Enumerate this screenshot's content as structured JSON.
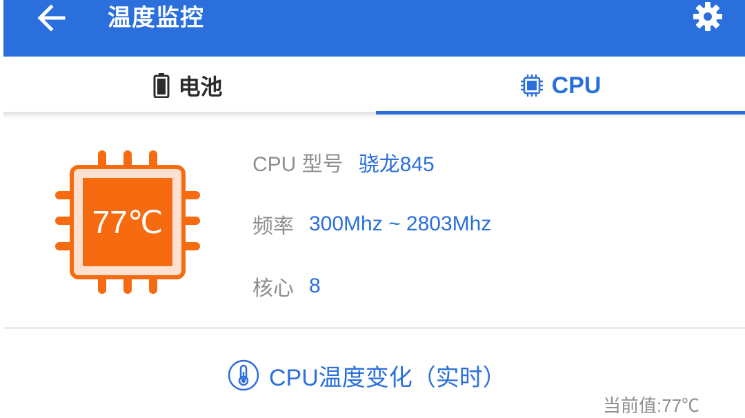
{
  "appbar": {
    "title": "温度监控",
    "back_icon": "arrow-left-icon",
    "settings_icon": "gear-icon"
  },
  "tabs": [
    {
      "label": "电池",
      "icon": "battery-icon",
      "active": false
    },
    {
      "label": "CPU",
      "icon": "cpu-chip-icon",
      "active": true
    }
  ],
  "cpu": {
    "temperature": "77℃",
    "model_label": "CPU 型号",
    "model_value": "骁龙845",
    "frequency_label": "频率",
    "frequency_value": "300Mhz ~ 2803Mhz",
    "cores_label": "核心",
    "cores_value": "8"
  },
  "chart": {
    "title": "CPU温度变化（实时）",
    "icon": "thermometer-icon",
    "current_value": "当前值:77℃"
  },
  "colors": {
    "primary": "#2a6fdb",
    "chip_orange": "#f66a10",
    "text_gray": "#8e8e8e"
  }
}
